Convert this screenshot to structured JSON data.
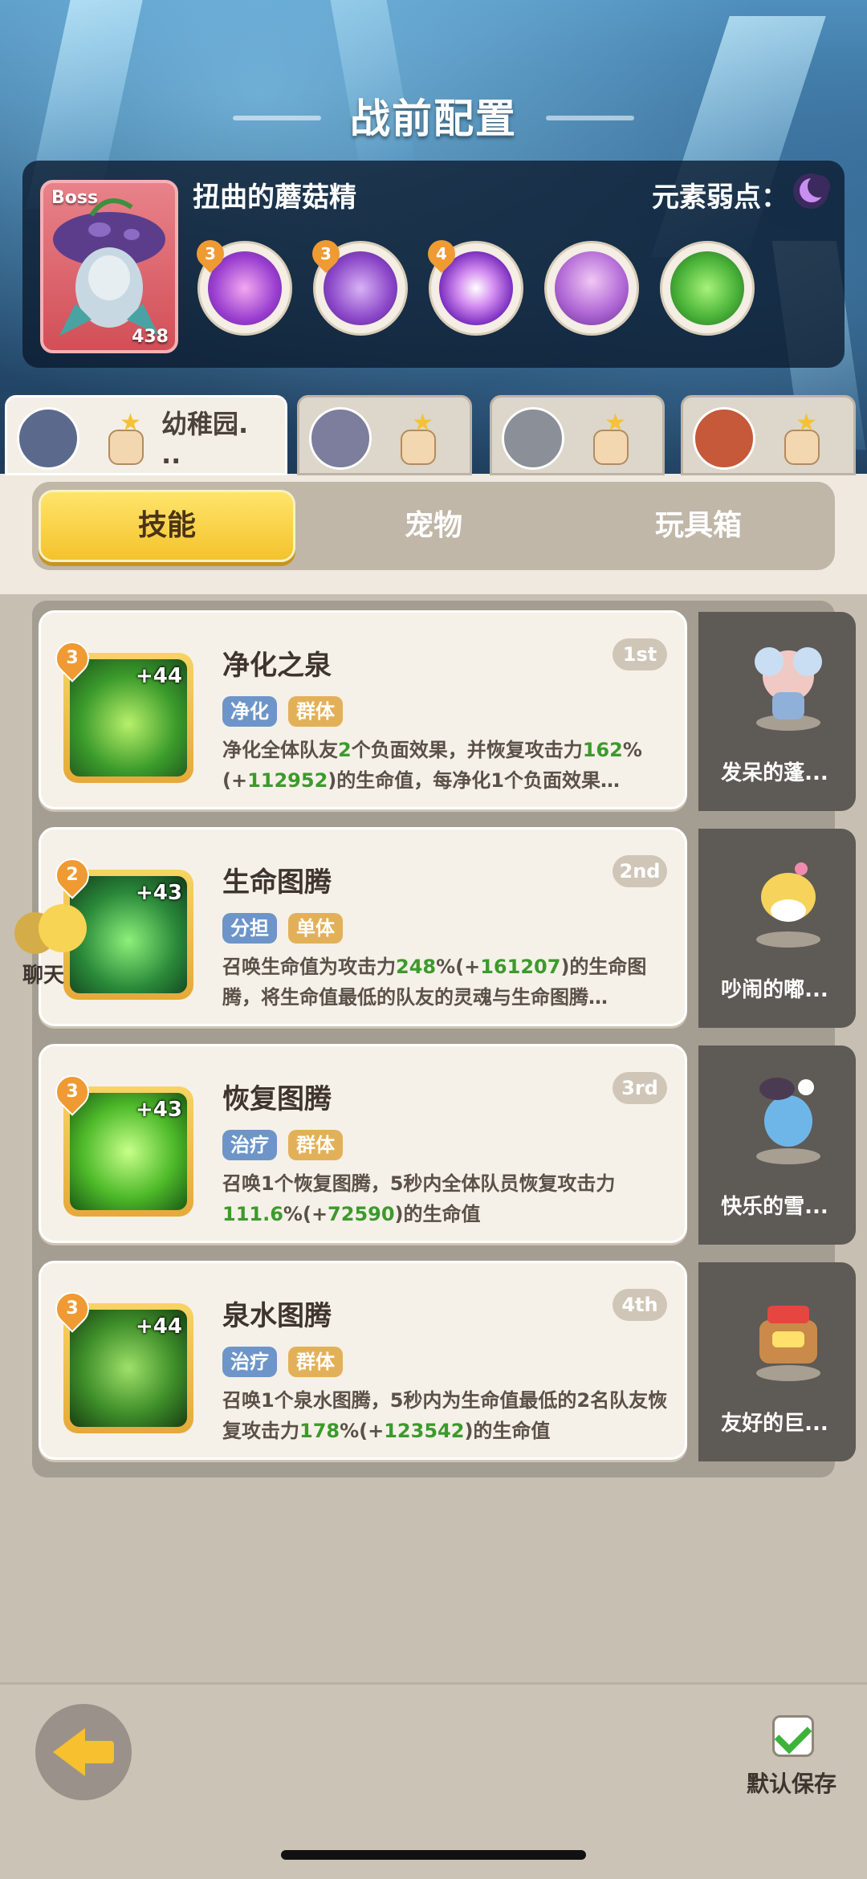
{
  "header": {
    "title": "战前配置"
  },
  "boss": {
    "tag": "Boss",
    "level": "438",
    "name": "扭曲的蘑菇精",
    "weakness_label": "元素弱点：",
    "weakness_icon": "moon-icon",
    "skills": [
      {
        "icon": "purple-swirl-skill-icon",
        "badge": "3"
      },
      {
        "icon": "purple-drop-skill-icon",
        "badge": "3"
      },
      {
        "icon": "purple-mushroom-burst-skill-icon",
        "badge": "4"
      },
      {
        "icon": "purple-mushroom-skill-icon",
        "badge": ""
      },
      {
        "icon": "green-slime-skill-icon",
        "badge": ""
      }
    ]
  },
  "party": [
    {
      "name": "幼稚园.\n..",
      "active": true
    },
    {
      "name": "",
      "active": false
    },
    {
      "name": "",
      "active": false
    },
    {
      "name": "",
      "active": false
    }
  ],
  "tabs": {
    "skill": "技能",
    "pet": "宠物",
    "toybox": "玩具箱"
  },
  "skills": [
    {
      "name": "净化之泉",
      "rank": "1st",
      "level": "3",
      "plus": "+44",
      "tags": [
        "净化",
        "群体"
      ],
      "desc_parts": [
        "净化全体队友",
        "2",
        "个负面效果，并恢复攻击力",
        "162",
        "%(+",
        "112952",
        ")的生命值，每净化1个负面效果…"
      ],
      "pet": "发呆的蓬..."
    },
    {
      "name": "生命图腾",
      "rank": "2nd",
      "level": "2",
      "plus": "+43",
      "tags": [
        "分担",
        "单体"
      ],
      "desc_parts": [
        "召唤生命值为攻击力",
        "248",
        "%(+",
        "161207",
        ")的生命图腾，将生命值最低的队友的灵魂与生命图腾…"
      ],
      "pet": "吵闹的嘟..."
    },
    {
      "name": "恢复图腾",
      "rank": "3rd",
      "level": "3",
      "plus": "+43",
      "tags": [
        "治疗",
        "群体"
      ],
      "desc_parts": [
        "召唤1个恢复图腾，5秒内全体队员恢复攻击力",
        "111.6",
        "%(+",
        "72590",
        ")的生命值"
      ],
      "pet": "快乐的雪..."
    },
    {
      "name": "泉水图腾",
      "rank": "4th",
      "level": "3",
      "plus": "+44",
      "tags": [
        "治疗",
        "群体"
      ],
      "desc_parts": [
        "召唤1个泉水图腾，5秒内为生命值最低的2名队友恢复攻击力",
        "178",
        "%(+",
        "123542",
        ")的生命值"
      ],
      "pet": "友好的巨..."
    }
  ],
  "side": {
    "chat_label": "聊天"
  },
  "footer": {
    "save_label": "默认保存",
    "save_checked": true
  }
}
